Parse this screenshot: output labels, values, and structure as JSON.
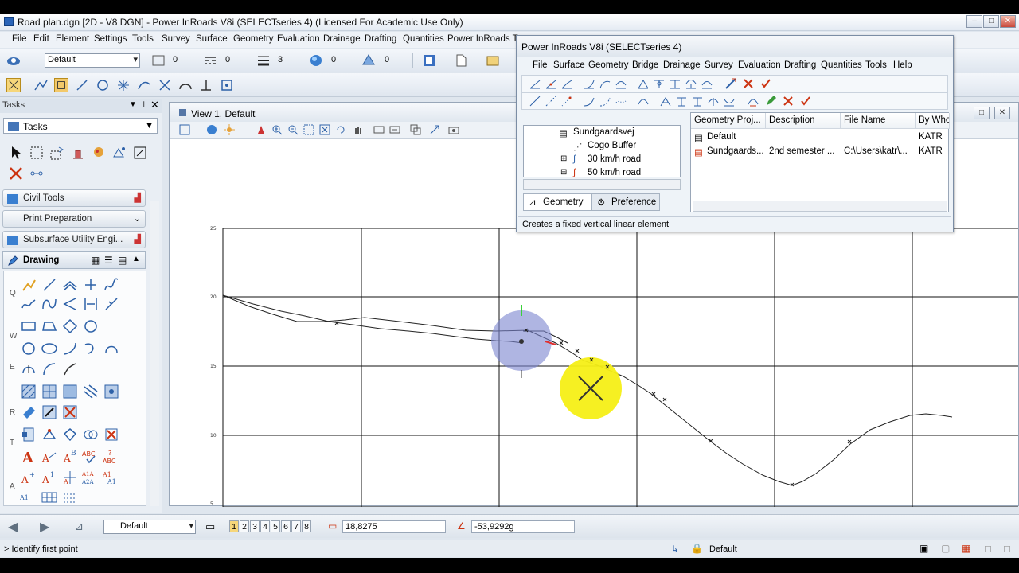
{
  "window": {
    "title": "Road plan.dgn [2D - V8 DGN] - Power InRoads V8i (SELECTseries 4) (Licensed For Academic Use Only)"
  },
  "menu": [
    "File",
    "Edit",
    "Element",
    "Settings",
    "Tools",
    "Survey",
    "Surface",
    "Geometry",
    "Evaluation",
    "Drainage",
    "Drafting",
    "Quantities",
    "Power InRoads To"
  ],
  "attributes": {
    "level": "Default",
    "color": "0",
    "style": "0",
    "weight": "3",
    "transparency": "0",
    "priority": "0"
  },
  "tasks": {
    "header": "Tasks",
    "combo": "Tasks",
    "sections": [
      "Civil Tools",
      "Print Preparation",
      "Subsurface Utility Engi..."
    ],
    "drawing": "Drawing",
    "row_keys": [
      "Q",
      "W",
      "E",
      "R",
      "T",
      "A"
    ]
  },
  "view": {
    "title": "View 1, Default",
    "y_ticks": [
      "25",
      "20",
      "15",
      "10",
      "5"
    ]
  },
  "pir": {
    "title": "Power InRoads V8i (SELECTseries 4)",
    "menu": [
      "File",
      "Surface",
      "Geometry",
      "Bridge",
      "Drainage",
      "Survey",
      "Evaluation",
      "Drafting",
      "Quantities",
      "Tools",
      "Help"
    ],
    "tree": [
      "Sundgaardsvej",
      "Cogo Buffer",
      "30 km/h road",
      "50 km/h road"
    ],
    "tabs": [
      "Geometry",
      "Preference"
    ],
    "columns": [
      "Geometry Proj...",
      "Description",
      "File Name",
      "By Who"
    ],
    "rows": [
      [
        "Default",
        "",
        "",
        "KATR"
      ],
      [
        "Sundgaards...",
        "2nd semester ...",
        "C:\\Users\\katr\\...",
        "KATR"
      ]
    ],
    "status": "Creates a fixed vertical linear element"
  },
  "bottom": {
    "level": "Default",
    "pages": [
      "1",
      "2",
      "3",
      "4",
      "5",
      "6",
      "7",
      "8"
    ],
    "x_value": "18,8275",
    "angle_value": "-53,9292g"
  },
  "status": {
    "prompt": "> Identify first point",
    "level": "Default"
  }
}
